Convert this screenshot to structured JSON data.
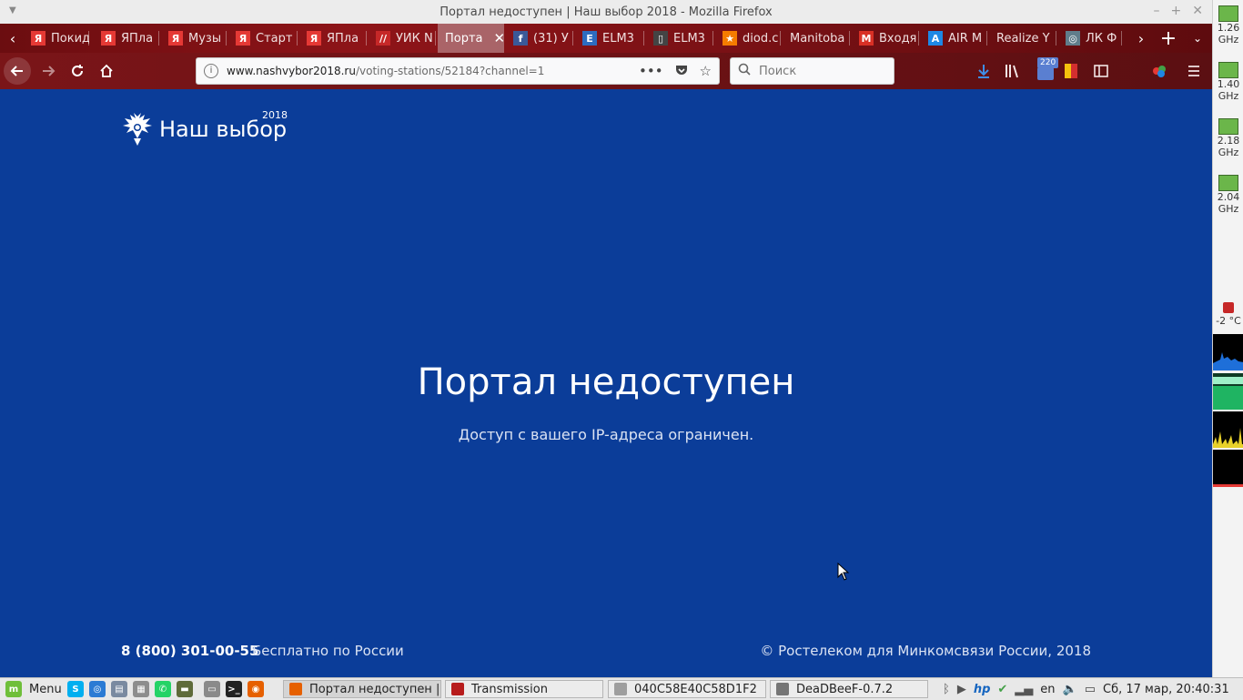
{
  "window": {
    "title": "Портал недоступен | Наш выбор 2018 - Mozilla Firefox",
    "min": "–",
    "max": "+",
    "close": "✕"
  },
  "tabs": [
    {
      "label": "Покид",
      "icon": "yandex-icon",
      "color": "#e53935",
      "glyph": "Я"
    },
    {
      "label": "ЯПла",
      "icon": "yandex-icon",
      "color": "#e53935",
      "glyph": "Я"
    },
    {
      "label": "Музы",
      "icon": "yandex-icon",
      "color": "#e53935",
      "glyph": "Я"
    },
    {
      "label": "Старт",
      "icon": "yandex-icon",
      "color": "#e53935",
      "glyph": "Я"
    },
    {
      "label": "ЯПла",
      "icon": "yandex-icon",
      "color": "#e53935",
      "glyph": "Я"
    },
    {
      "label": "УИК N",
      "icon": "cik-icon",
      "color": "#c62828",
      "glyph": "//"
    },
    {
      "label": "Порта",
      "icon": "",
      "color": "",
      "glyph": "",
      "active": true
    },
    {
      "label": "(31) У",
      "icon": "facebook-icon",
      "color": "#3b5998",
      "glyph": "f"
    },
    {
      "label": "ELM3",
      "icon": "elm-icon",
      "color": "#2d6cc0",
      "glyph": "E"
    },
    {
      "label": "ELM3",
      "icon": "elm-chip-icon",
      "color": "#444",
      "glyph": "▯"
    },
    {
      "label": "diod.c",
      "icon": "diod-icon",
      "color": "#f57c00",
      "glyph": "★"
    },
    {
      "label": "Manitoba",
      "icon": "",
      "color": "",
      "glyph": ""
    },
    {
      "label": "Входя",
      "icon": "gmail-icon",
      "color": "#d93025",
      "glyph": "M"
    },
    {
      "label": "AIR M",
      "icon": "air-icon",
      "color": "#1e88e5",
      "glyph": "A"
    },
    {
      "label": "Realize Y",
      "icon": "",
      "color": "",
      "glyph": ""
    },
    {
      "label": "ЛК Ф",
      "icon": "lk-icon",
      "color": "#607d8b",
      "glyph": "◎"
    }
  ],
  "navbar": {
    "url_host": "www.nashvybor2018.ru",
    "url_path": "/voting-stations/52184?channel=1",
    "search_placeholder": "Поиск",
    "badge": "220"
  },
  "page": {
    "logo_name": "Наш выбор",
    "logo_year": "2018",
    "heading": "Портал недоступен",
    "subtext": "Доступ с вашего IP-адреса ограничен.",
    "phone": "8 (800) 301-00-55",
    "free": "Бесплатно по России",
    "copyright": "© Ростелеком для Минкомсвязи России, 2018"
  },
  "sidepanel": {
    "cpus": [
      {
        "v": "1.26",
        "u": "GHz"
      },
      {
        "v": "1.40",
        "u": "GHz"
      },
      {
        "v": "2.18",
        "u": "GHz"
      },
      {
        "v": "2.04",
        "u": "GHz"
      }
    ],
    "temp": "-2 °C"
  },
  "taskbar": {
    "menu": "Menu",
    "windows": [
      {
        "label": "Портал недоступен | ...",
        "active": true,
        "color": "#e66000"
      },
      {
        "label": "Transmission",
        "active": false,
        "color": "#b71c1c"
      },
      {
        "label": "040C58E40C58D1F2",
        "active": false,
        "color": "#9e9e9e"
      },
      {
        "label": "DeaDBeeF-0.7.2",
        "active": false,
        "color": "#757575"
      }
    ],
    "lang": "en",
    "clock": "Сб, 17 мар, 20:40:31"
  }
}
